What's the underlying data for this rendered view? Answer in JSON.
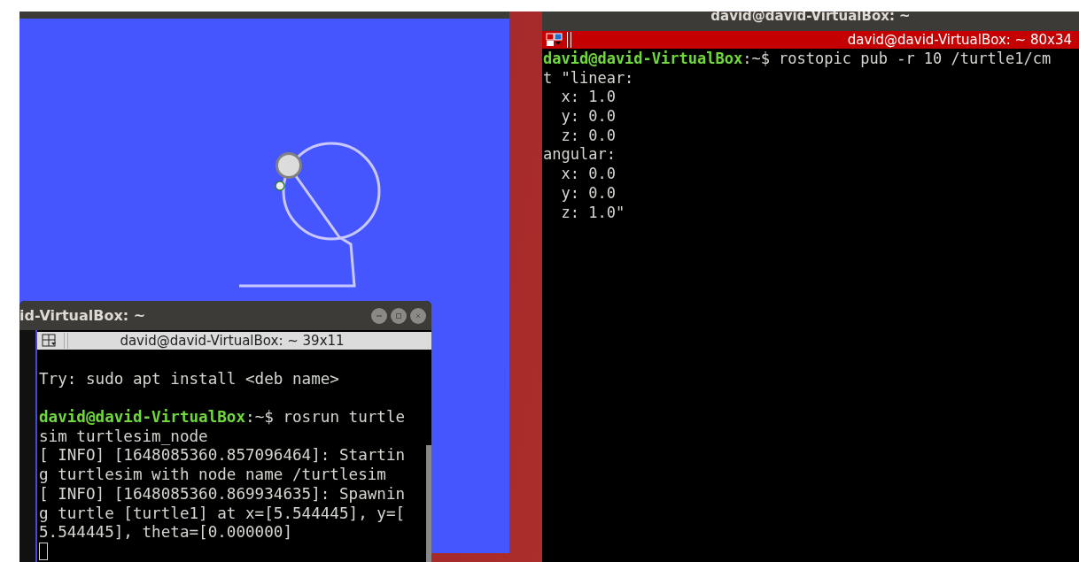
{
  "right_terminal": {
    "title": "david@david-VirtualBox: ~",
    "tab_title": "david@david-VirtualBox: ~ 80x34",
    "lines": [
      {
        "kind": "prompt",
        "user": "david@david-VirtualBox",
        "text": ":~$ rostopic pub -r 10 /turtle1/cm"
      },
      {
        "kind": "output",
        "text": "t \"linear:"
      },
      {
        "kind": "output",
        "text": "  x: 1.0"
      },
      {
        "kind": "output",
        "text": "  y: 0.0"
      },
      {
        "kind": "output",
        "text": "  z: 0.0"
      },
      {
        "kind": "output",
        "text": "angular:"
      },
      {
        "kind": "output",
        "text": "  x: 0.0"
      },
      {
        "kind": "output",
        "text": "  y: 0.0"
      },
      {
        "kind": "output",
        "text": "  z: 1.0\""
      }
    ]
  },
  "left_terminal": {
    "title": "id-VirtualBox: ~",
    "tab_title": "david@david-VirtualBox: ~ 39x11",
    "lines": [
      {
        "kind": "blank"
      },
      {
        "kind": "output",
        "text": "Try: sudo apt install <deb name>"
      },
      {
        "kind": "blank"
      },
      {
        "kind": "prompt",
        "user": "david@david-VirtualBox",
        "text": ":~$ rosrun turtle"
      },
      {
        "kind": "output",
        "text": "sim turtlesim_node"
      },
      {
        "kind": "output",
        "text": "[ INFO] [1648085360.857096464]: Startin"
      },
      {
        "kind": "output",
        "text": "g turtlesim with node name /turtlesim"
      },
      {
        "kind": "output",
        "text": "[ INFO] [1648085360.869934635]: Spawnin"
      },
      {
        "kind": "output",
        "text": "g turtle [turtle1] at x=[5.544445], y=["
      },
      {
        "kind": "output",
        "text": "5.544445], theta=[0.000000]"
      },
      {
        "kind": "cursor"
      }
    ]
  }
}
